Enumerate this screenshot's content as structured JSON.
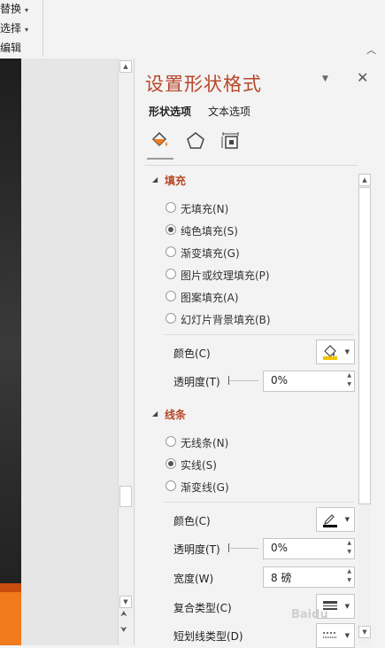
{
  "ribbon": {
    "replace_label": "替换",
    "select_label": "选择",
    "group_label": "编辑"
  },
  "pane": {
    "title": "设置形状格式",
    "tabs": [
      "形状选项",
      "文本选项"
    ],
    "fill_section": {
      "title": "填充",
      "options": [
        "无填充(N)",
        "纯色填充(S)",
        "渐变填充(G)",
        "图片或纹理填充(P)",
        "图案填充(A)",
        "幻灯片背景填充(B)"
      ],
      "selected_index": 1,
      "color_label": "颜色(C)",
      "transparency_label": "透明度(T)",
      "transparency_value": "0%"
    },
    "line_section": {
      "title": "线条",
      "options": [
        "无线条(N)",
        "实线(S)",
        "渐变线(G)"
      ],
      "selected_index": 1,
      "color_label": "颜色(C)",
      "transparency_label": "透明度(T)",
      "transparency_value": "0%",
      "width_label": "宽度(W)",
      "width_value": "8 磅",
      "compound_label": "复合类型(C)",
      "dash_label": "短划线类型(D)"
    }
  },
  "watermark": "Baidu",
  "colors": {
    "accent": "#b7472a",
    "fill_swatch": "#f2c300",
    "line_swatch": "#000000",
    "orange": "#f07a1c"
  }
}
